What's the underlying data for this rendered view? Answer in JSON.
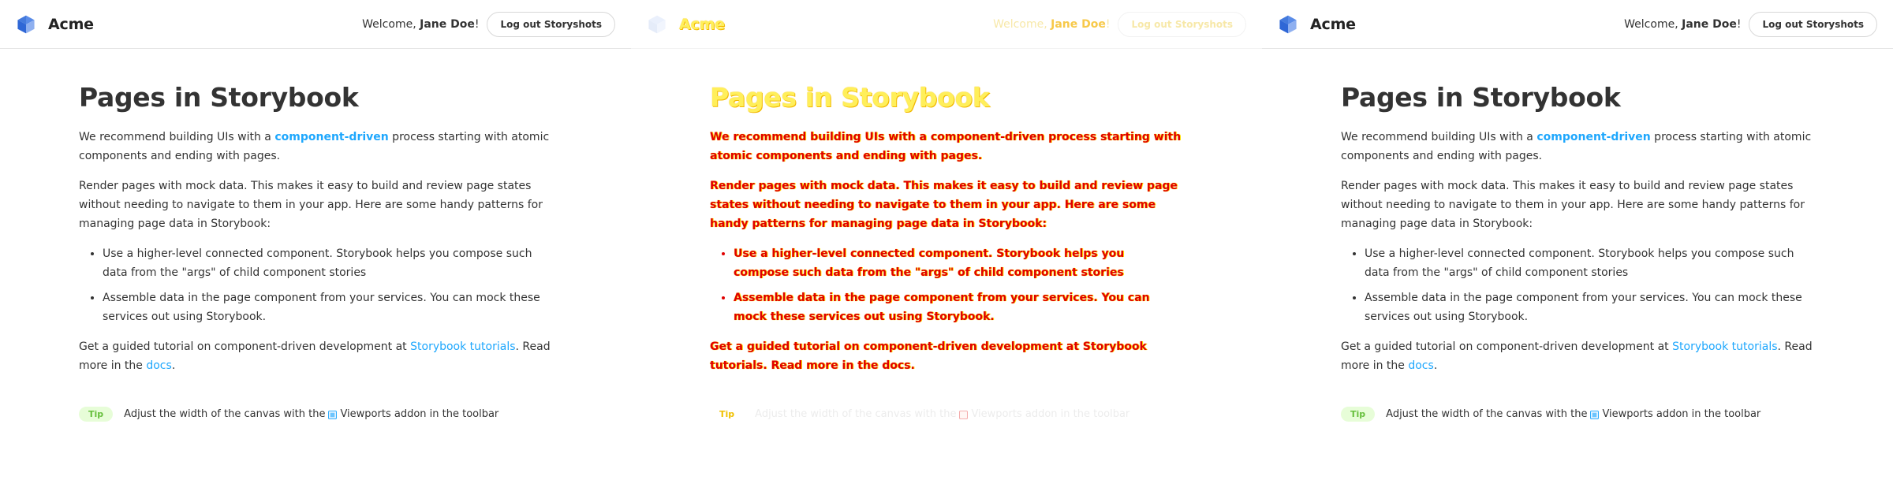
{
  "panels": [
    {
      "role": "baseline",
      "header": {
        "brand": "Acme",
        "welcome_prefix": "Welcome, ",
        "user_name": "Jane Doe",
        "welcome_suffix": "!",
        "logout_label": "Log out Storyshots"
      },
      "main": {
        "title": "Pages in Storybook",
        "p1_before": "We recommend building UIs with a ",
        "p1_link": "component-driven",
        "p1_after": " process starting with atomic components and ending with pages.",
        "p2": "Render pages with mock data. This makes it easy to build and review page states without needing to navigate to them in your app. Here are some handy patterns for managing page data in Storybook:",
        "bullets": [
          "Use a higher-level connected component. Storybook helps you compose such data from the \"args\" of child component stories",
          "Assemble data in the page component from your services. You can mock these services out using Storybook."
        ],
        "p3_before": "Get a guided tutorial on component-driven development at ",
        "p3_link1": "Storybook tutorials",
        "p3_mid": ". Read more in the ",
        "p3_link2": "docs",
        "p3_end": ".",
        "tip_badge": "Tip",
        "tip_before": "Adjust the width of the canvas with the ",
        "tip_after": "Viewports addon in the toolbar"
      }
    },
    {
      "role": "diff",
      "header": {
        "brand": "Acme",
        "welcome_prefix": "Welcome, ",
        "user_name": "Jane Doe",
        "welcome_suffix": "!",
        "logout_label": "Log out Storyshots"
      },
      "main": {
        "title": "Pages in Storybook",
        "p1_before": "We recommend building UIs with a ",
        "p1_link": "component-driven",
        "p1_after": " process starting with atomic components and ending with pages.",
        "p2": "Render pages with mock data. This makes it easy to build and review page states without needing to navigate to them in your app. Here are some handy patterns for managing page data in Storybook:",
        "bullets": [
          "Use a higher-level connected component. Storybook helps you compose such data from the \"args\" of child component stories",
          "Assemble data in the page component from your services. You can mock these services out using Storybook."
        ],
        "p3_before": "Get a guided tutorial on component-driven development at ",
        "p3_link1": "Storybook tutorials",
        "p3_mid": ". Read more in the ",
        "p3_link2": "docs",
        "p3_end": ".",
        "tip_badge": "Tip",
        "tip_before": "Adjust the width of the canvas with the ",
        "tip_after": "Viewports addon in the toolbar"
      }
    },
    {
      "role": "current",
      "header": {
        "brand": "Acme",
        "welcome_prefix": "Welcome, ",
        "user_name": "Jane Doe",
        "welcome_suffix": "!",
        "logout_label": "Log out Storyshots"
      },
      "main": {
        "title": "Pages in Storybook",
        "p1_before": "We recommend building UIs with a ",
        "p1_link": "component-driven",
        "p1_after": " process starting with atomic components and ending with pages.",
        "p2": "Render pages with mock data. This makes it easy to build and review page states without needing to navigate to them in your app. Here are some handy patterns for managing page data in Storybook:",
        "bullets": [
          "Use a higher-level connected component. Storybook helps you compose such data from the \"args\" of child component stories",
          "Assemble data in the page component from your services. You can mock these services out using Storybook."
        ],
        "p3_before": "Get a guided tutorial on component-driven development at ",
        "p3_link1": "Storybook tutorials",
        "p3_mid": ". Read more in the ",
        "p3_link2": "docs",
        "p3_end": ".",
        "tip_badge": "Tip",
        "tip_before": "Adjust the width of the canvas with the ",
        "tip_after": "Viewports addon in the toolbar"
      }
    }
  ],
  "icons": {
    "logo": "acme-cube-logo-icon",
    "viewport": "viewports-icon"
  },
  "colors": {
    "link": "#1ea7fd",
    "tip_text": "#66bf3c",
    "tip_bg": "#e7fdd8",
    "logo_light": "#029cfd",
    "logo_dark": "#1e58c9",
    "diff_red": "#e00000",
    "diff_yellow": "#ffe100"
  }
}
